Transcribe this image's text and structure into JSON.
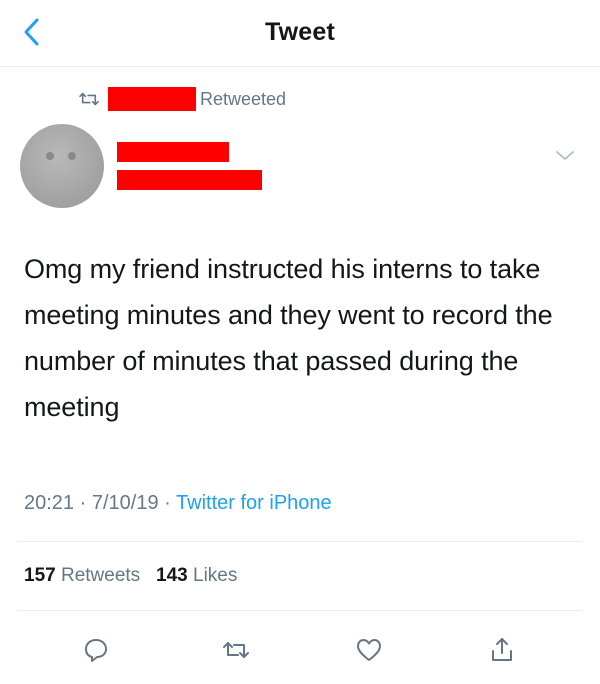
{
  "header": {
    "title": "Tweet",
    "back_icon": "chevron-left-icon"
  },
  "retweet_banner": {
    "label": "Retweeted",
    "icon": "retweet-icon"
  },
  "tweet": {
    "text": "Omg my friend instructed his interns to take meeting minutes and they went to record the number of minutes that passed during the meeting",
    "time": "20:21",
    "date": "7/10/19",
    "separator": "·",
    "source": "Twitter for iPhone"
  },
  "stats": {
    "retweets_count": "157",
    "retweets_label": "Retweets",
    "likes_count": "143",
    "likes_label": "Likes"
  },
  "actions": [
    "reply-icon",
    "retweet-icon",
    "like-icon",
    "share-icon"
  ],
  "colors": {
    "accent": "#1da1f2",
    "secondary_text": "#657786",
    "primary_text": "#14171a",
    "divider": "#e6ecf0",
    "redaction": "#ff0000"
  }
}
